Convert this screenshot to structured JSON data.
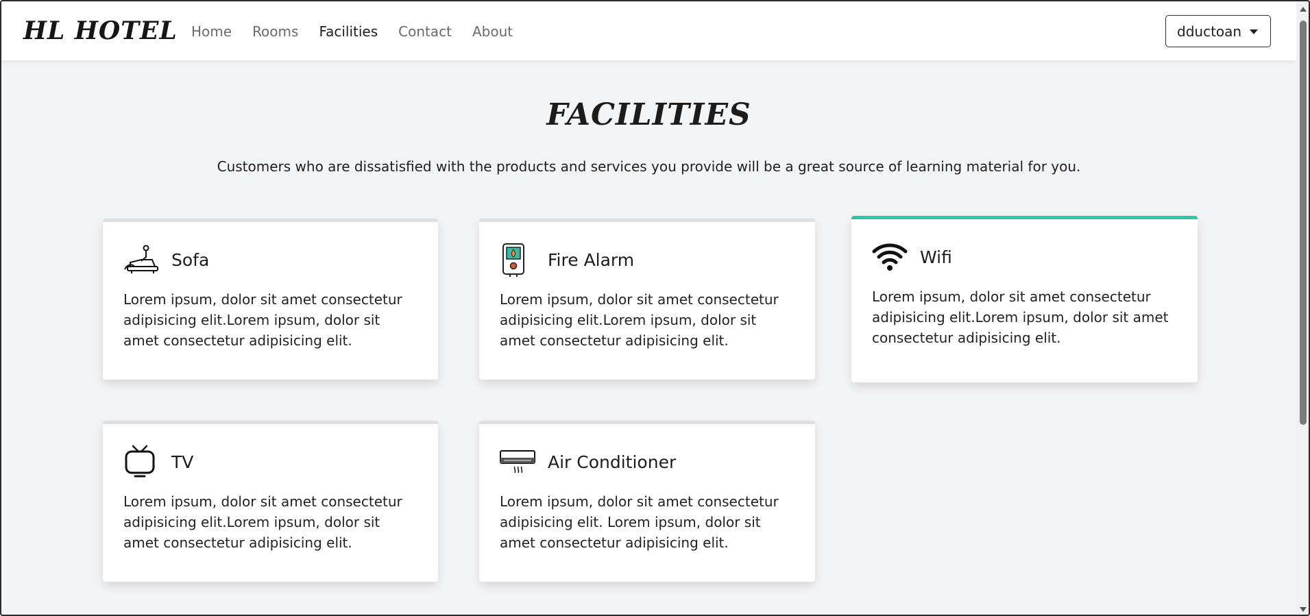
{
  "brand": "HL HOTEL",
  "nav": {
    "links": [
      "Home",
      "Rooms",
      "Facilities",
      "Contact",
      "About"
    ],
    "active_index": 2
  },
  "user": {
    "name": "dductoan"
  },
  "page": {
    "title": "FACILITIES",
    "subtitle": "Customers who are dissatisfied with the products and services you provide will be a great source of learning material for you."
  },
  "facilities": [
    {
      "title": "Sofa",
      "icon": "sofa-icon",
      "text": "Lorem ipsum, dolor sit amet consectetur adipisicing elit.Lorem ipsum, dolor sit amet consectetur adipisicing elit."
    },
    {
      "title": "Fire Alarm",
      "icon": "fire-alarm-icon",
      "text": "Lorem ipsum, dolor sit amet consectetur adipisicing elit.Lorem ipsum, dolor sit amet consectetur adipisicing elit."
    },
    {
      "title": "Wifi",
      "icon": "wifi-icon",
      "text": "Lorem ipsum, dolor sit amet consectetur adipisicing elit.Lorem ipsum, dolor sit amet consectetur adipisicing elit."
    },
    {
      "title": "TV",
      "icon": "tv-icon",
      "text": "Lorem ipsum, dolor sit amet consectetur adipisicing elit.Lorem ipsum, dolor sit amet consectetur adipisicing elit."
    },
    {
      "title": "Air Conditioner",
      "icon": "air-conditioner-icon",
      "text": "Lorem ipsum, dolor sit amet consectetur adipisicing elit. Lorem ipsum, dolor sit amet consectetur adipisicing elit."
    }
  ],
  "colors": {
    "accent": "#2ec4a6",
    "card_border": "#dedfe1",
    "background": "#f3f4f6"
  }
}
